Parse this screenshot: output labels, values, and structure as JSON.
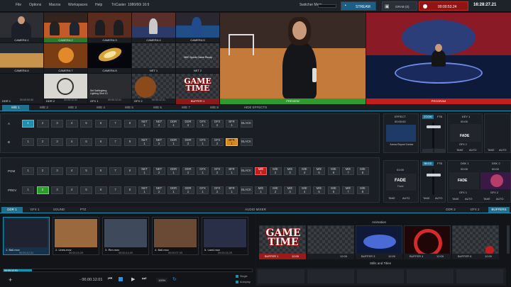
{
  "topbar": {
    "menu": [
      "File",
      "Options",
      "Macros",
      "Workspaces",
      "Help",
      "TriCaster",
      "1080/60i 16:9"
    ],
    "switcher_label": "Switcher Mem",
    "stream_label": "STREAM",
    "grab_label": "GRAB",
    "grab_count": "(0)",
    "record_time": "00:00:53.24",
    "clock": "16:28:27.21"
  },
  "multiview": {
    "cells": [
      "CAMERA 1",
      "CAMERA 2",
      "CAMERA 3",
      "CAMERA 4",
      "CAMERA 5",
      "CAMERA 6",
      "CAMERA 7",
      "CAMERA 8",
      "NET 1",
      "NET 2"
    ],
    "ddr_row": [
      "DDR 1",
      "DDR 2",
      "GFX 1",
      "GFX 2"
    ],
    "ddr_times": [
      "00:00:00.00",
      "00:00:12.01",
      "00:00:12.01",
      "00:00:12.01"
    ],
    "clip_caption": "Set Sattlegberg Lighting Shot 10",
    "net_caption": "NBC Sports Game Recap"
  },
  "previews": {
    "buffer": "BUFFER 1",
    "preview": "PREVIEW",
    "program": "PROGRAM",
    "gametime": "GAME TIME"
  },
  "me_tabs": [
    "M/E 1",
    "M/E 2",
    "M/E 3",
    "M/E 4",
    "M/E 5",
    "M/E 6",
    "M/E 7",
    "M/E 8",
    "HIDE EFFECTS"
  ],
  "me_rows": {
    "a_label": "A",
    "b_label": "B",
    "a_buttons": [
      "1",
      "2",
      "3",
      "4",
      "5",
      "6",
      "7",
      "8",
      "NET 1",
      "NET 2",
      "DDR 1",
      "DDR 2",
      "GFX 1",
      "GFX 2",
      "BFR 1",
      "BLACK"
    ],
    "b_buttons": [
      "1",
      "2",
      "3",
      "4",
      "5",
      "6",
      "7",
      "8",
      "NET 1",
      "NET 2",
      "DDR 1",
      "DDR 2",
      "GFX 1",
      "GFX 2",
      "BFR 1",
      "BLACK"
    ]
  },
  "me_side": {
    "effect": "EFFECT",
    "effect_time": "00:00:00",
    "effect_name": "Arena Report Center",
    "zoom": "ZOOM",
    "ftb": "FTB",
    "key1": "KEY 1",
    "key_time": "00:00",
    "fade": "FADE",
    "gfx1": "GFX 1",
    "take": "TAKE",
    "auto": "AUTO"
  },
  "main_rows": {
    "pgm_label": "PGM",
    "prev_label": "PREV",
    "pgm_buttons": [
      "1",
      "2",
      "3",
      "4",
      "5",
      "6",
      "7",
      "8",
      "NET 1",
      "NET 2",
      "DDR 1",
      "DDR 2",
      "GFX 1",
      "GFX 2",
      "BFR 1",
      "BLACK",
      "M/E 1",
      "M/E 2",
      "M/E 3",
      "M/E 4",
      "M/E 5",
      "M/E 6",
      "M/E 7",
      "M/E 8"
    ],
    "prev_buttons": [
      "1",
      "2",
      "3",
      "4",
      "5",
      "6",
      "7",
      "8",
      "NET 1",
      "NET 2",
      "DDR 1",
      "DDR 2",
      "GFX 1",
      "GFX 2",
      "BFR 1",
      "BLACK",
      "M/E 1",
      "M/E 2",
      "M/E 3",
      "M/E 4",
      "M/E 5",
      "M/E 6",
      "M/E 7",
      "M/E 8"
    ]
  },
  "transition": {
    "time": "01:00",
    "fade": "FADE",
    "fade_sub": "Fade",
    "bkgd": "BKGD",
    "ftb": "FTB",
    "take": "TAKE",
    "auto": "AUTO",
    "dsk1": "DSK 1",
    "dsk2": "DSK 2",
    "dsk_time": "00:00",
    "dsk_fade": "FADE",
    "gfx1": "GFX 1",
    "gfx2": "GFX 2"
  },
  "bottom_tabs": {
    "left": [
      "DDR 1",
      "GFX 1",
      "SOUND",
      "PTZ"
    ],
    "center": "AUDIO MIXER",
    "right": [
      "DDR 2",
      "GFX 2",
      "BUFFERS"
    ]
  },
  "ddr": {
    "clips": [
      {
        "name": "1. Ball.mov",
        "dur": "00:00:12.01"
      },
      {
        "name": "2. Lines.mov",
        "dur": "00:00:19.29"
      },
      {
        "name": "3. Rim.mov",
        "dur": "00:00:14.00"
      },
      {
        "name": "4. Ball.mov",
        "dur": "00:00:07.00"
      },
      {
        "name": "5. Land.mov",
        "dur": "00:00:15.29"
      }
    ],
    "position": "00:00:12.01",
    "remaining": "- 00.00.12.01",
    "speed": "100%",
    "single": "Single",
    "autoplay": "Autoplay"
  },
  "buffers": {
    "animation_title": "Animation",
    "stills_title": "Stills and Titles",
    "items": [
      {
        "label": "BUFFER 1",
        "time": "12:00"
      },
      {
        "label": "",
        "time": "12:00"
      },
      {
        "label": "BUFFER 3",
        "time": "12:00"
      },
      {
        "label": "BUFFER 4",
        "time": "12:00"
      },
      {
        "label": "BUFFER 5",
        "time": "12:00"
      }
    ]
  },
  "colors": {
    "accent": "#1f8fb0",
    "program": "#c31e1e",
    "preview": "#2f9a2f",
    "orange": "#d8871a"
  }
}
